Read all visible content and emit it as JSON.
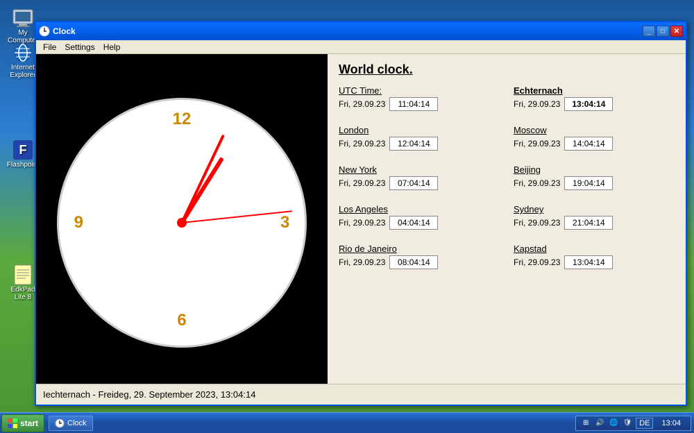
{
  "desktop": {
    "icons": [
      {
        "id": "my-computer",
        "label": "My Computer"
      },
      {
        "id": "internet-explorer",
        "label": "Internet Explorer"
      },
      {
        "id": "flashpoint",
        "label": "Flashpoint"
      },
      {
        "id": "edkpad",
        "label": "EdkPad Lite 8"
      }
    ]
  },
  "window": {
    "title": "Clock",
    "menu": {
      "items": [
        "File",
        "Settings",
        "Help"
      ]
    }
  },
  "world_clock": {
    "title": "World clock.",
    "entries": [
      {
        "city": "UTC Time:",
        "bold": false,
        "date": "Fri, 29.09.23",
        "time": "11:04:14",
        "bold_time": false,
        "col": 0
      },
      {
        "city": "Echternach",
        "bold": true,
        "date": "Fri, 29.09.23",
        "time": "13:04:14",
        "bold_time": true,
        "col": 1
      },
      {
        "city": "London",
        "bold": false,
        "date": "Fri, 29.09.23",
        "time": "12:04:14",
        "bold_time": false,
        "col": 0
      },
      {
        "city": "Moscow",
        "bold": false,
        "date": "Fri, 29.09.23",
        "time": "14:04:14",
        "bold_time": false,
        "col": 1
      },
      {
        "city": "New York",
        "bold": false,
        "date": "Fri, 29.09.23",
        "time": "07:04:14",
        "bold_time": false,
        "col": 0
      },
      {
        "city": "Beijing",
        "bold": false,
        "date": "Fri, 29.09.23",
        "time": "19:04:14",
        "bold_time": false,
        "col": 1
      },
      {
        "city": "Los Angeles",
        "bold": false,
        "date": "Fri, 29.09.23",
        "time": "04:04:14",
        "bold_time": false,
        "col": 0
      },
      {
        "city": "Sydney",
        "bold": false,
        "date": "Fri, 29.09.23",
        "time": "21:04:14",
        "bold_time": false,
        "col": 1
      },
      {
        "city": "Rio de Janeiro",
        "bold": false,
        "date": "Fri, 29.09.23",
        "time": "08:04:14",
        "bold_time": false,
        "col": 0
      },
      {
        "city": "Kapstad",
        "bold": false,
        "date": "Fri, 29.09.23",
        "time": "13:04:14",
        "bold_time": false,
        "col": 1
      }
    ]
  },
  "status_bar": {
    "text": "Iechternach  -  Freideg, 29. September 2023, 13:04:14"
  },
  "clock": {
    "numbers": {
      "twelve": "12",
      "three": "3",
      "six": "6",
      "nine": "9"
    },
    "hour_rotation": 20,
    "minute_rotation": 25,
    "second_rotation": 90
  },
  "taskbar": {
    "start_label": "start",
    "clock_app_label": "Clock",
    "time": "13:04",
    "lang": "DE"
  }
}
